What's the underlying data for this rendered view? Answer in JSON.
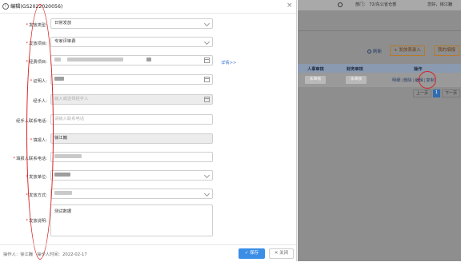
{
  "header": {
    "notification_count": "",
    "dept": "部门： 72/东公省仓部",
    "greeting": "您好，徐江巍"
  },
  "toolbar": {
    "refresh_label": "刷新",
    "add_label": "+ 发放表录入",
    "my_label": "我的填报"
  },
  "table": {
    "columns": [
      "人事审核",
      "财务审核",
      "操作"
    ],
    "row": {
      "hr_status": "未审核",
      "finance_status": "未审核",
      "ops": [
        "明细",
        "删除",
        "编辑",
        "复制"
      ]
    }
  },
  "pager": {
    "prev": "上一页",
    "page": "1",
    "next": "下一页"
  },
  "modal": {
    "title": "编辑(GS2022020056)",
    "close": "×",
    "labels": {
      "issue_type": "发放类型:",
      "issue_item": "发放项目:",
      "funding_project": "经费项目:",
      "witness": "证明人:",
      "handler": "经手人:",
      "handler_phone": "经手人联系电话:",
      "reporter": "填报人:",
      "reporter_phone": "填报人联系电话:",
      "issue_unit": "发放单位:",
      "issue_method": "发放方式:",
      "issue_note": "发放说明:"
    },
    "values": {
      "issue_type": "日常发放",
      "issue_item": "专家评审费",
      "reporter": "徐江巍",
      "issue_note": "测试数据"
    },
    "placeholders": {
      "handler": "输入或选择经手人",
      "handler_phone": "请输入联系电话"
    },
    "detail_link": "详情>>",
    "footer": {
      "operator_label": "操作人：",
      "operator": "徐江巍",
      "op_time_label": "操作人时间：",
      "op_time": "2022-02-17"
    },
    "buttons": {
      "save": "✓ 保存",
      "close": "✕ 关闭"
    }
  },
  "colors": {
    "primary": "#3a8ee6",
    "required": "#e22222",
    "annotation": "#d82020",
    "overlay": "#8e8e8e"
  }
}
